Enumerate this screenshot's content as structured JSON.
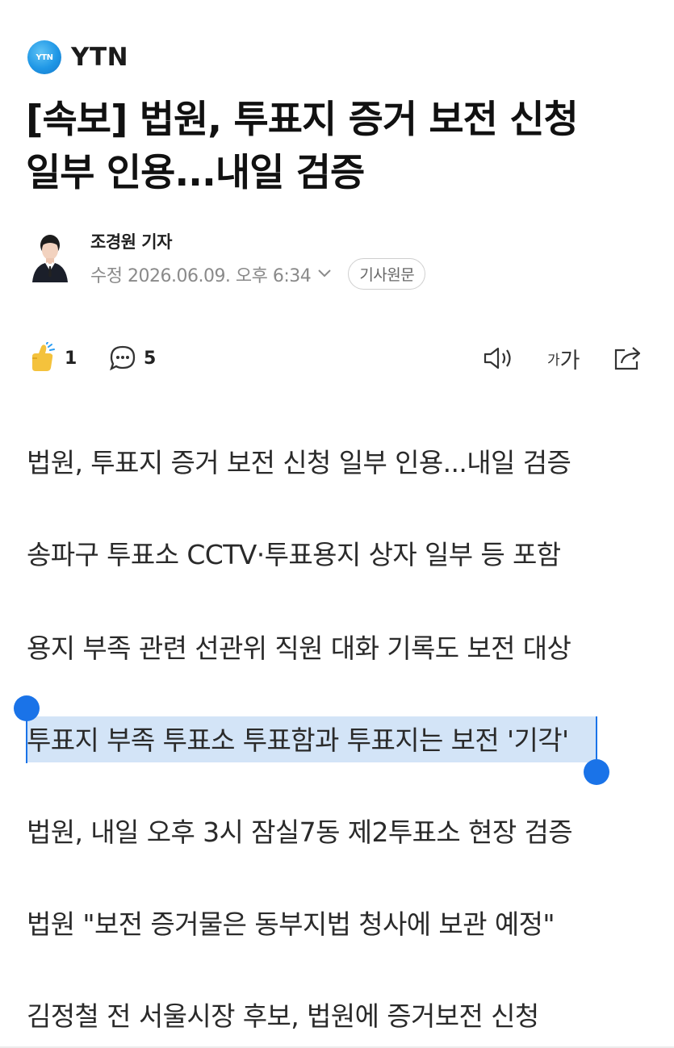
{
  "press": {
    "logo_text": "YTN",
    "name": "YTN",
    "brand_color": "#1f97e6"
  },
  "article": {
    "headline": "[속보] 법원, 투표지 증거 보전 신청\n일부 인용...내일 검증",
    "reporter": "조경원 기자",
    "timestamp": "수정 2026.06.09. 오후 6:34",
    "original_button": "기사원문"
  },
  "actions": {
    "like_count": "1",
    "comment_count": "5",
    "font_small": "가",
    "font_large": "가"
  },
  "summary": [
    "법원, 투표지 증거 보전 신청 일부 인용...내일 검증",
    "송파구 투표소 CCTV·투표용지 상자 일부 등 포함",
    "용지 부족 관련 선관위 직원 대화 기록도 보전 대상",
    "투표지 부족 투표소 투표함과 투표지는 보전 '기각'",
    "법원, 내일 오후 3시 잠실7동 제2투표소 현장 검증",
    "법원 \"보전 증거물은 동부지법 청사에 보관 예정\"",
    "김정철 전 서울시장 후보, 법원에 증거보전 신청"
  ],
  "selection": {
    "selected_line_index": 3,
    "highlight_color": "#d3e4f7",
    "handle_color": "#1a73e8"
  }
}
